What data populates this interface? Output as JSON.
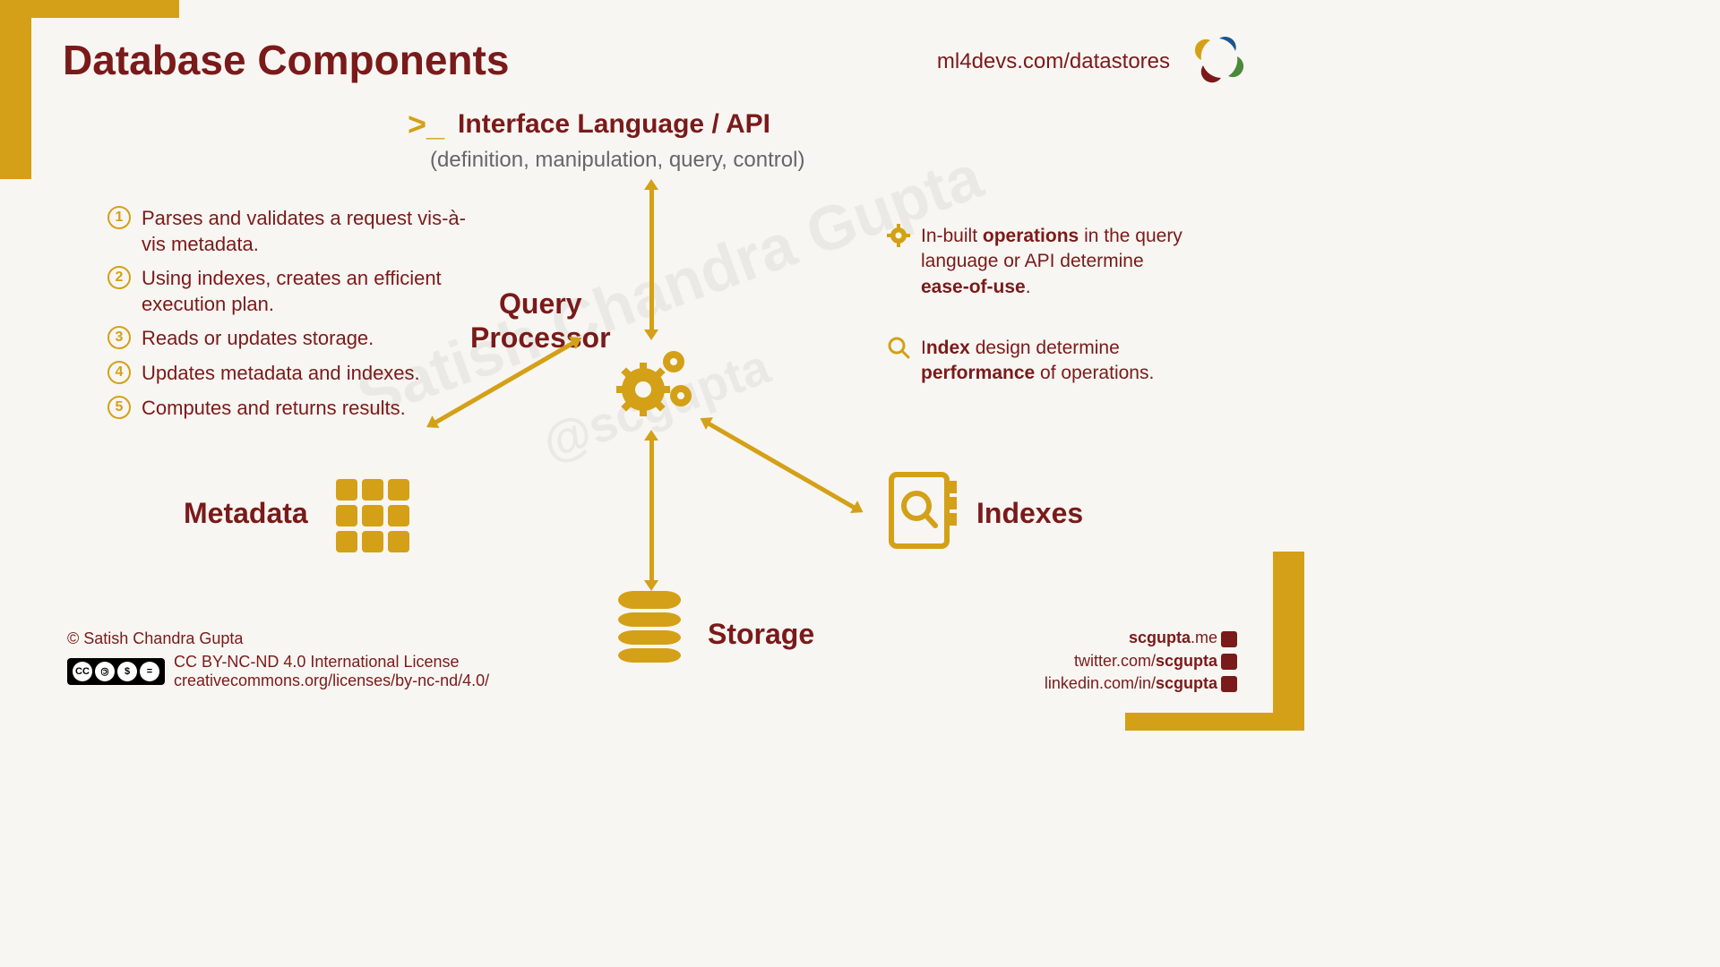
{
  "title": "Database Components",
  "url": "ml4devs.com/datastores",
  "interface": {
    "title": "Interface Language / API",
    "subtitle": "(definition, manipulation, query, control)"
  },
  "query_processor_label": "Query\nProcessor",
  "nodes": {
    "metadata": "Metadata",
    "storage": "Storage",
    "indexes": "Indexes"
  },
  "steps": [
    "Parses and validates a request vis-à-vis metadata.",
    "Using indexes, creates an efficient execution plan.",
    "Reads or updates storage.",
    "Updates metadata and indexes.",
    "Computes and returns results."
  ],
  "notes": {
    "0": {
      "pre": "In-built ",
      "b1": "operations",
      "mid": " in the query language or API determine ",
      "b2": "ease-of-use",
      "post": "."
    },
    "1": {
      "pre": "I",
      "b1": "ndex",
      "mid": " design determine ",
      "b2": "performance",
      "post": " of operations."
    }
  },
  "footer": {
    "copyright": "© Satish Chandra Gupta",
    "license": "CC BY-NC-ND 4.0 International License",
    "license_url": "creativecommons.org/licenses/by-nc-nd/4.0/",
    "links": {
      "site": {
        "pre": "scgupta",
        "post": ".me"
      },
      "twitter": {
        "pre": "twitter.com/",
        "bold": "scgupta"
      },
      "linkedin": {
        "pre": "linkedin.com/in/",
        "bold": "scgupta"
      }
    }
  },
  "watermark1": "Satish Chandra Gupta",
  "watermark2": "@scgupta"
}
